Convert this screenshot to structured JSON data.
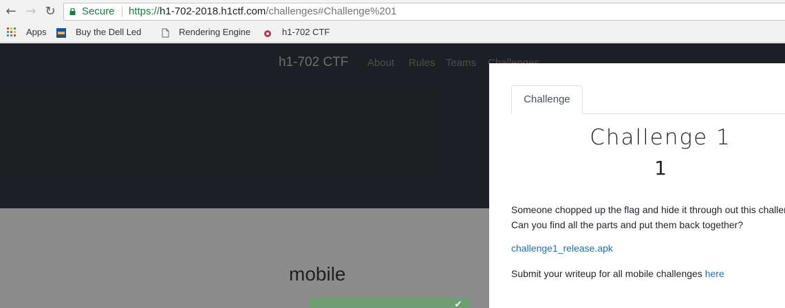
{
  "browser": {
    "secure_label": "Secure",
    "url_scheme": "https://",
    "url_host": "h1-702-2018.h1ctf.com",
    "url_path": "/challenges#Challenge%201",
    "bookmarks": [
      {
        "label": "Apps",
        "icon": "apps-grid-icon"
      },
      {
        "label": "Buy the Dell Led",
        "icon": "dell-bookmark-icon"
      },
      {
        "label": "Rendering Engine",
        "icon": "page-icon"
      },
      {
        "label": "h1-702 CTF",
        "icon": "h1-ctf-icon"
      }
    ]
  },
  "site": {
    "brand": "h1-702 CTF",
    "nav": [
      "About",
      "Rules",
      "Teams",
      "Challenges"
    ]
  },
  "section": {
    "title": "mobile"
  },
  "modal": {
    "tab_label": "Challenge",
    "title": "Challenge 1",
    "points": "1",
    "description_line1": "Someone chopped up the flag and hide it through out this challenge.",
    "description_line2": "Can you find all the parts and put them back together?",
    "file_link": "challenge1_release.apk",
    "submit_text": "Submit your writeup for all mobile challenges",
    "submit_link": "here"
  },
  "colors": {
    "hero_bg": "#343a40",
    "secure_green": "#188038",
    "link_blue": "#1d70b8",
    "card_green": "#6f9e74"
  }
}
